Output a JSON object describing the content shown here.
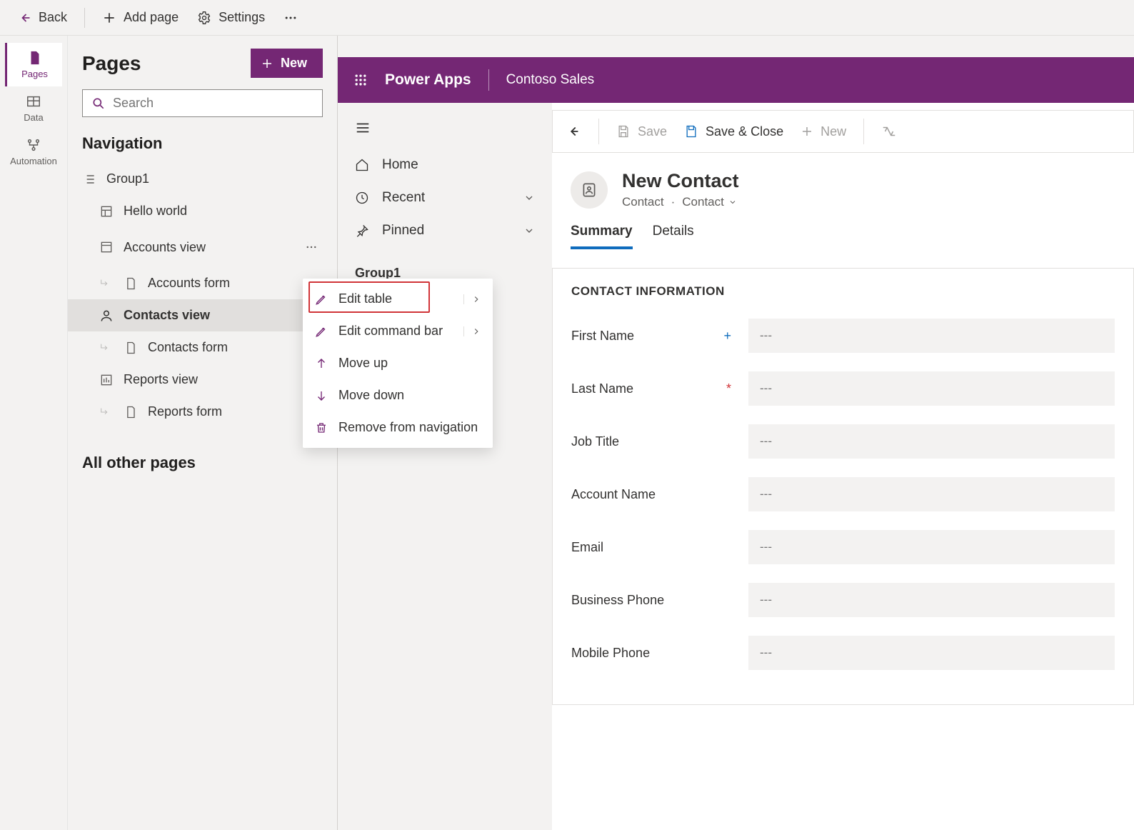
{
  "top": {
    "back": "Back",
    "addPage": "Add page",
    "settings": "Settings"
  },
  "rail": {
    "pages": "Pages",
    "data": "Data",
    "automation": "Automation"
  },
  "pagesPanel": {
    "title": "Pages",
    "newBtn": "New",
    "searchPlaceholder": "Search",
    "navTitle": "Navigation",
    "group": "Group1",
    "items": [
      {
        "label": "Hello world"
      },
      {
        "label": "Accounts view"
      },
      {
        "label": "Accounts form"
      },
      {
        "label": "Contacts view"
      },
      {
        "label": "Contacts form"
      },
      {
        "label": "Reports view"
      },
      {
        "label": "Reports form"
      }
    ],
    "allOther": "All other pages"
  },
  "contextMenu": {
    "editTable": "Edit table",
    "editCommandBar": "Edit command bar",
    "moveUp": "Move up",
    "moveDown": "Move down",
    "remove": "Remove from navigation"
  },
  "preview": {
    "brand": "Power Apps",
    "appName": "Contoso Sales",
    "sidebar": {
      "home": "Home",
      "recent": "Recent",
      "pinned": "Pinned",
      "group": "Group1"
    },
    "cmd": {
      "save": "Save",
      "saveClose": "Save & Close",
      "new": "New"
    },
    "record": {
      "title": "New Contact",
      "entity": "Contact",
      "sep": "·",
      "form": "Contact"
    },
    "tabs": {
      "summary": "Summary",
      "details": "Details"
    },
    "formSection": "CONTACT INFORMATION",
    "fields": {
      "firstName": "First Name",
      "lastName": "Last Name",
      "jobTitle": "Job Title",
      "accountName": "Account Name",
      "email": "Email",
      "businessPhone": "Business Phone",
      "mobilePhone": "Mobile Phone",
      "placeholder": "---"
    }
  }
}
